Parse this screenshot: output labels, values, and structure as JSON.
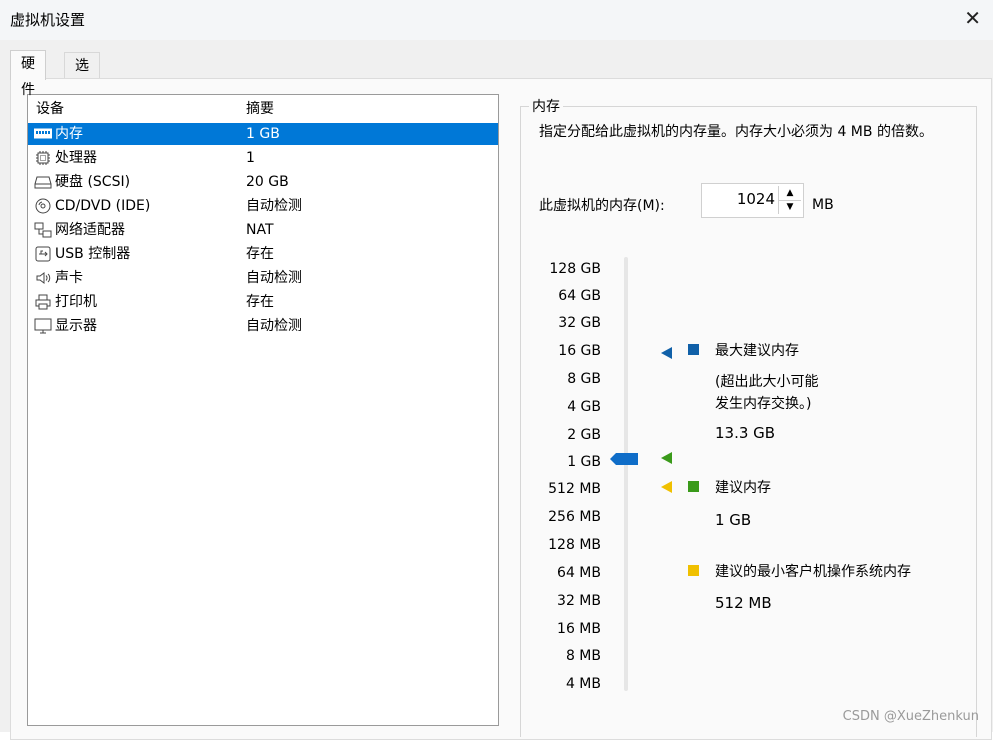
{
  "window": {
    "title": "虚拟机设置",
    "close_symbol": "✕"
  },
  "tabs": [
    {
      "label": "硬件",
      "active": true
    },
    {
      "label": "选项",
      "active": false
    }
  ],
  "device_list": {
    "headers": {
      "device": "设备",
      "summary": "摘要"
    },
    "items": [
      {
        "icon": "memory-icon",
        "name": "内存",
        "summary": "1 GB",
        "selected": true
      },
      {
        "icon": "processor-icon",
        "name": "处理器",
        "summary": "1"
      },
      {
        "icon": "hard-disk-icon",
        "name": "硬盘 (SCSI)",
        "summary": "20 GB"
      },
      {
        "icon": "cd-dvd-icon",
        "name": "CD/DVD (IDE)",
        "summary": "自动检测"
      },
      {
        "icon": "network-adapter-icon",
        "name": "网络适配器",
        "summary": "NAT"
      },
      {
        "icon": "usb-controller-icon",
        "name": "USB 控制器",
        "summary": "存在"
      },
      {
        "icon": "sound-card-icon",
        "name": "声卡",
        "summary": "自动检测"
      },
      {
        "icon": "printer-icon",
        "name": "打印机",
        "summary": "存在"
      },
      {
        "icon": "display-icon",
        "name": "显示器",
        "summary": "自动检测"
      }
    ]
  },
  "memory": {
    "group_title": "内存",
    "description": "指定分配给此虚拟机的内存量。内存大小必须为 4 MB 的倍数。",
    "field_label": "此虚拟机的内存(M):",
    "value": "1024",
    "unit": "MB",
    "scale": [
      "128 GB",
      "64 GB",
      "32 GB",
      "16 GB",
      "8 GB",
      "4 GB",
      "2 GB",
      "1 GB",
      "512 MB",
      "256 MB",
      "128 MB",
      "64 MB",
      "32 MB",
      "16 MB",
      "8 MB",
      "4 MB"
    ],
    "current": "1 GB",
    "max_recommended": {
      "label": "最大建议内存",
      "note_line1": "(超出此大小可能",
      "note_line2": "发生内存交换。)",
      "value": "13.3 GB",
      "color": "#1060a8"
    },
    "recommended": {
      "label": "建议内存",
      "value": "1 GB",
      "color": "#3a9a1a"
    },
    "min_guest_os": {
      "label": "建议的最小客户机操作系统内存",
      "value": "512 MB",
      "color": "#f0c000"
    },
    "slider_color": "#0f6dc8"
  },
  "watermark": "CSDN @XueZhenkun"
}
